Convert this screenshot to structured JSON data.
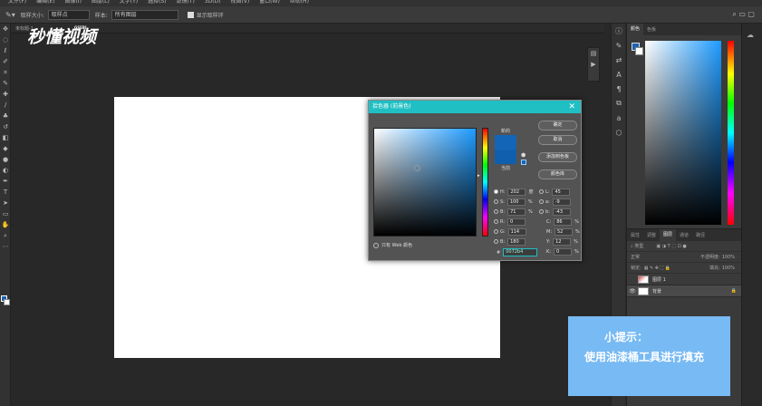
{
  "menu": [
    "文件(F)",
    "编辑(E)",
    "图像(I)",
    "图层(L)",
    "文字(Y)",
    "选择(S)",
    "滤镜(T)",
    "3D(D)",
    "视图(V)",
    "窗口(W)",
    "帮助(H)"
  ],
  "options_bar": {
    "sample_size_label": "取样大小:",
    "sample_size_value": "取样点",
    "sample_label": "样本:",
    "sample_value": "所有图层",
    "show_ring_label": "显示取样环"
  },
  "doc_tab": "未标题-1",
  "logo": {
    "text": "秒懂视频",
    "sub": "GSEBI"
  },
  "right_panel": {
    "color_tabs": [
      "颜色",
      "色板"
    ],
    "layers_tabs": [
      "属性",
      "调整",
      "图层",
      "通道",
      "路径"
    ],
    "kind_label": "类型",
    "blend_mode": "正常",
    "opacity_label": "不透明度:",
    "opacity_value": "100%",
    "lock_label": "锁定:",
    "fill_label": "填充:",
    "fill_value": "100%",
    "layers": [
      {
        "name": "图层 1",
        "selected": false
      },
      {
        "name": "背景",
        "selected": true
      }
    ]
  },
  "dialog": {
    "title": "拾色器 (前景色)",
    "new_label": "新的",
    "current_label": "当前",
    "buttons": {
      "ok": "确定",
      "cancel": "取消",
      "add_swatch": "添加到色板",
      "libraries": "颜色库"
    },
    "hsb": [
      {
        "key": "H:",
        "value": "202",
        "unit": "度",
        "checked": true
      },
      {
        "key": "S:",
        "value": "100",
        "unit": "%",
        "checked": false
      },
      {
        "key": "B:",
        "value": "71",
        "unit": "%",
        "checked": false
      }
    ],
    "rgb": [
      {
        "key": "R:",
        "value": "0"
      },
      {
        "key": "G:",
        "value": "114"
      },
      {
        "key": "B:",
        "value": "180"
      }
    ],
    "lab": [
      {
        "key": "L:",
        "value": "45"
      },
      {
        "key": "a:",
        "value": "-9"
      },
      {
        "key": "b:",
        "value": "-43"
      }
    ],
    "cmyk": [
      {
        "key": "C:",
        "value": "86",
        "unit": "%"
      },
      {
        "key": "M:",
        "value": "52",
        "unit": "%"
      },
      {
        "key": "Y:",
        "value": "12",
        "unit": "%"
      },
      {
        "key": "K:",
        "value": "0",
        "unit": "%"
      }
    ],
    "hex_label": "#",
    "hex_value": "0072b4",
    "web_only_label": "只有 Web 颜色"
  },
  "tip": {
    "title": "小提示：",
    "body": "使用油漆桶工具进行填充"
  },
  "colors": {
    "accent": "#1fbfc3",
    "tip_bg": "#78baf3",
    "foreground": "#0072b4"
  }
}
